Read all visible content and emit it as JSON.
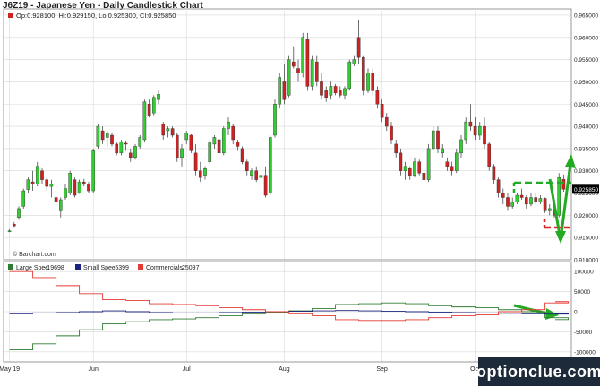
{
  "title": "J6Z19 - Japanese Yen - Daily Candlestick Chart",
  "ohlc_legend": "Op:0.928100, Hi:0.929150, Lo:0.925300, Cl:0.925850",
  "copyright": "© Barchart.com",
  "watermark": "optionclue.com",
  "colors": {
    "up": "#33cc33",
    "down": "#cc2222",
    "large_spec": "#2e7d32",
    "small_spec": "#1a237e",
    "commercials": "#e53935",
    "annotation_green": "#22aa22",
    "annotation_red": "#dd2222",
    "grid": "#d8d8d8"
  },
  "chart_data": [
    {
      "type": "candlestick",
      "price_axis_ticks": [
        "0.965000",
        "0.960000",
        "0.955000",
        "0.950000",
        "0.945000",
        "0.940000",
        "0.935000",
        "0.930000",
        "0.925000",
        "0.920000",
        "0.915000",
        "0.910000"
      ],
      "ylim": [
        0.91,
        0.966
      ],
      "last_price": "0.925850",
      "month_labels": [
        {
          "label": "May 19",
          "index": 0
        },
        {
          "label": "Jun",
          "index": 18
        },
        {
          "label": "Jul",
          "index": 38
        },
        {
          "label": "Aug",
          "index": 59
        },
        {
          "label": "Sep",
          "index": 80
        },
        {
          "label": "Oct",
          "index": 100
        }
      ],
      "candles": [
        [
          0.9165,
          0.9168,
          0.9162,
          0.9165
        ],
        [
          0.918,
          0.9185,
          0.9172,
          0.9176
        ],
        [
          0.9195,
          0.922,
          0.919,
          0.9215
        ],
        [
          0.922,
          0.926,
          0.9215,
          0.9255
        ],
        [
          0.9258,
          0.9285,
          0.925,
          0.928
        ],
        [
          0.9275,
          0.93,
          0.9255,
          0.927
        ],
        [
          0.927,
          0.932,
          0.9265,
          0.931
        ],
        [
          0.93,
          0.9305,
          0.927,
          0.928
        ],
        [
          0.928,
          0.9285,
          0.9255,
          0.9265
        ],
        [
          0.9265,
          0.928,
          0.924,
          0.927
        ],
        [
          0.924,
          0.927,
          0.921,
          0.923
        ],
        [
          0.921,
          0.924,
          0.9195,
          0.9235
        ],
        [
          0.924,
          0.927,
          0.9235,
          0.926
        ],
        [
          0.925,
          0.93,
          0.9245,
          0.9295
        ],
        [
          0.928,
          0.9285,
          0.924,
          0.9245
        ],
        [
          0.925,
          0.928,
          0.9248,
          0.9275
        ],
        [
          0.9275,
          0.9282,
          0.9265,
          0.9272
        ],
        [
          0.927,
          0.9275,
          0.925,
          0.9255
        ],
        [
          0.9255,
          0.935,
          0.925,
          0.9345
        ],
        [
          0.9355,
          0.9405,
          0.935,
          0.94
        ],
        [
          0.939,
          0.94,
          0.936,
          0.937
        ],
        [
          0.9375,
          0.939,
          0.9355,
          0.9385
        ],
        [
          0.938,
          0.9385,
          0.9355,
          0.936
        ],
        [
          0.936,
          0.9365,
          0.9335,
          0.934
        ],
        [
          0.934,
          0.937,
          0.9335,
          0.9365
        ],
        [
          0.9362,
          0.9368,
          0.9345,
          0.936
        ],
        [
          0.934,
          0.935,
          0.932,
          0.933
        ],
        [
          0.933,
          0.936,
          0.9325,
          0.9355
        ],
        [
          0.9355,
          0.938,
          0.935,
          0.9375
        ],
        [
          0.937,
          0.946,
          0.9365,
          0.9455
        ],
        [
          0.945,
          0.946,
          0.942,
          0.9425
        ],
        [
          0.943,
          0.947,
          0.9425,
          0.9465
        ],
        [
          0.946,
          0.948,
          0.945,
          0.9472
        ],
        [
          0.9405,
          0.941,
          0.937,
          0.938
        ],
        [
          0.939,
          0.94,
          0.9375,
          0.9395
        ],
        [
          0.9395,
          0.94,
          0.9375,
          0.938
        ],
        [
          0.938,
          0.9385,
          0.932,
          0.933
        ],
        [
          0.933,
          0.936,
          0.931,
          0.935
        ],
        [
          0.937,
          0.939,
          0.936,
          0.9385
        ],
        [
          0.938,
          0.9382,
          0.934,
          0.9345
        ],
        [
          0.934,
          0.936,
          0.929,
          0.93
        ],
        [
          0.93,
          0.932,
          0.9275,
          0.9285
        ],
        [
          0.929,
          0.931,
          0.928,
          0.9305
        ],
        [
          0.932,
          0.937,
          0.9315,
          0.9365
        ],
        [
          0.936,
          0.938,
          0.935,
          0.9375
        ],
        [
          0.937,
          0.9375,
          0.933,
          0.934
        ],
        [
          0.934,
          0.94,
          0.9335,
          0.9395
        ],
        [
          0.9395,
          0.942,
          0.938,
          0.941
        ],
        [
          0.94,
          0.9405,
          0.936,
          0.937
        ],
        [
          0.9365,
          0.937,
          0.9345,
          0.9355
        ],
        [
          0.935,
          0.9355,
          0.9315,
          0.932
        ],
        [
          0.932,
          0.9325,
          0.929,
          0.93
        ],
        [
          0.929,
          0.9305,
          0.928,
          0.93
        ],
        [
          0.93,
          0.931,
          0.9275,
          0.928
        ],
        [
          0.9285,
          0.93,
          0.927,
          0.929
        ],
        [
          0.929,
          0.931,
          0.924,
          0.9245
        ],
        [
          0.925,
          0.938,
          0.9245,
          0.9375
        ],
        [
          0.938,
          0.946,
          0.9375,
          0.945
        ],
        [
          0.945,
          0.952,
          0.944,
          0.951
        ],
        [
          0.95,
          0.954,
          0.945,
          0.946
        ],
        [
          0.947,
          0.956,
          0.9465,
          0.955
        ],
        [
          0.9545,
          0.958,
          0.953,
          0.9535
        ],
        [
          0.953,
          0.955,
          0.95,
          0.952
        ],
        [
          0.952,
          0.961,
          0.951,
          0.96
        ],
        [
          0.9595,
          0.961,
          0.948,
          0.949
        ],
        [
          0.949,
          0.956,
          0.948,
          0.955
        ],
        [
          0.9545,
          0.956,
          0.949,
          0.95
        ],
        [
          0.95,
          0.952,
          0.946,
          0.947
        ],
        [
          0.948,
          0.949,
          0.9455,
          0.9465
        ],
        [
          0.947,
          0.95,
          0.946,
          0.949
        ],
        [
          0.949,
          0.9495,
          0.947,
          0.9475
        ],
        [
          0.948,
          0.949,
          0.9465,
          0.947
        ],
        [
          0.947,
          0.949,
          0.946,
          0.9485
        ],
        [
          0.9485,
          0.955,
          0.948,
          0.9545
        ],
        [
          0.954,
          0.956,
          0.9535,
          0.955
        ],
        [
          0.96,
          0.964,
          0.954,
          0.9555
        ],
        [
          0.9555,
          0.956,
          0.947,
          0.948
        ],
        [
          0.948,
          0.953,
          0.9475,
          0.952
        ],
        [
          0.952,
          0.953,
          0.947,
          0.948
        ],
        [
          0.948,
          0.949,
          0.944,
          0.945
        ],
        [
          0.945,
          0.946,
          0.941,
          0.942
        ],
        [
          0.942,
          0.943,
          0.939,
          0.94
        ],
        [
          0.94,
          0.941,
          0.936,
          0.937
        ],
        [
          0.936,
          0.937,
          0.933,
          0.934
        ],
        [
          0.934,
          0.935,
          0.929,
          0.93
        ],
        [
          0.93,
          0.932,
          0.928,
          0.931
        ],
        [
          0.9305,
          0.931,
          0.928,
          0.929
        ],
        [
          0.929,
          0.933,
          0.9285,
          0.932
        ],
        [
          0.932,
          0.9325,
          0.929,
          0.9295
        ],
        [
          0.9295,
          0.93,
          0.927,
          0.928
        ],
        [
          0.928,
          0.936,
          0.9275,
          0.935
        ],
        [
          0.935,
          0.94,
          0.9345,
          0.939
        ],
        [
          0.939,
          0.94,
          0.934,
          0.935
        ],
        [
          0.934,
          0.936,
          0.933,
          0.935
        ],
        [
          0.932,
          0.933,
          0.93,
          0.931
        ],
        [
          0.931,
          0.932,
          0.929,
          0.93
        ],
        [
          0.93,
          0.935,
          0.9295,
          0.934
        ],
        [
          0.934,
          0.938,
          0.933,
          0.937
        ],
        [
          0.937,
          0.942,
          0.936,
          0.941
        ],
        [
          0.941,
          0.945,
          0.939,
          0.94
        ],
        [
          0.94,
          0.942,
          0.937,
          0.938
        ],
        [
          0.938,
          0.941,
          0.937,
          0.94
        ],
        [
          0.94,
          0.942,
          0.935,
          0.936
        ],
        [
          0.936,
          0.9365,
          0.93,
          0.931
        ],
        [
          0.931,
          0.9315,
          0.927,
          0.928
        ],
        [
          0.928,
          0.9285,
          0.924,
          0.925
        ],
        [
          0.925,
          0.926,
          0.9225,
          0.924
        ],
        [
          0.924,
          0.925,
          0.921,
          0.922
        ],
        [
          0.922,
          0.924,
          0.9215,
          0.923
        ],
        [
          0.923,
          0.925,
          0.9225,
          0.9245
        ],
        [
          0.9245,
          0.926,
          0.9235,
          0.924
        ],
        [
          0.924,
          0.9245,
          0.9215,
          0.9225
        ],
        [
          0.9225,
          0.925,
          0.922,
          0.924
        ],
        [
          0.924,
          0.925,
          0.9225,
          0.923
        ],
        [
          0.923,
          0.9245,
          0.9225,
          0.9238
        ],
        [
          0.9238,
          0.924,
          0.9205,
          0.921
        ],
        [
          0.921,
          0.9225,
          0.92,
          0.9215
        ],
        [
          0.9215,
          0.922,
          0.9195,
          0.92
        ],
        [
          0.92,
          0.9295,
          0.9195,
          0.9285
        ],
        [
          0.9281,
          0.92915,
          0.9253,
          0.92585
        ]
      ]
    },
    {
      "type": "line",
      "legend": [
        {
          "name": "Large Spec",
          "value": "-19698"
        },
        {
          "name": "Small Spec",
          "value": "-5399"
        },
        {
          "name": "Commercials",
          "value": "25097"
        }
      ],
      "y_axis_ticks": [
        "100000",
        "50000",
        "0",
        "-50000",
        "-100000"
      ],
      "ylim": [
        -125000,
        125000
      ],
      "week_indices": [
        0,
        5,
        10,
        15,
        20,
        25,
        30,
        35,
        40,
        45,
        50,
        55,
        60,
        65,
        70,
        75,
        80,
        85,
        90,
        95,
        100,
        105,
        110,
        115,
        120
      ],
      "series": [
        {
          "name": "Large Spec",
          "values": [
            -95000,
            -80000,
            -60000,
            -45000,
            -30000,
            -25000,
            -20000,
            -18000,
            -15000,
            -10000,
            -5000,
            -2000,
            2000,
            8000,
            18000,
            20000,
            22000,
            20000,
            15000,
            12000,
            10000,
            5000,
            0,
            -15000,
            -19698
          ]
        },
        {
          "name": "Small Spec",
          "values": [
            -5000,
            -3000,
            -2000,
            0,
            2000,
            0,
            -2000,
            -3000,
            -3000,
            -2000,
            -1000,
            0,
            1000,
            2000,
            3000,
            2000,
            1000,
            0,
            -1000,
            -2000,
            -3000,
            -4000,
            -5000,
            -6000,
            -5399
          ]
        },
        {
          "name": "Commercials",
          "values": [
            100000,
            85000,
            65000,
            45000,
            30000,
            28000,
            20000,
            18000,
            15000,
            10000,
            5000,
            0,
            -5000,
            -10000,
            -20000,
            -22000,
            -22000,
            -20000,
            -15000,
            -10000,
            -8000,
            0,
            5000,
            22000,
            25097
          ]
        }
      ]
    }
  ]
}
